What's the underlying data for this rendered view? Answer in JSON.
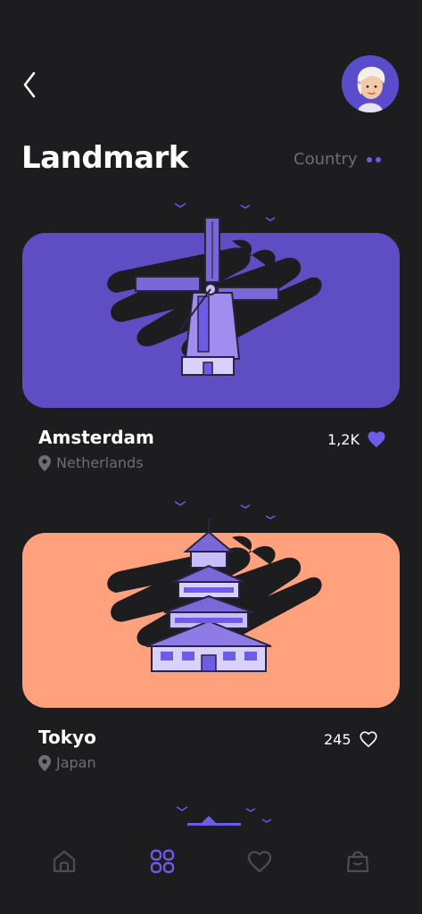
{
  "header": {
    "back_icon": "chevron-left-icon",
    "avatar_icon": "user-avatar"
  },
  "page": {
    "title": "Landmark",
    "filter_label": "Country"
  },
  "landmarks": [
    {
      "city": "Amsterdam",
      "country": "Netherlands",
      "likes": "1,2K",
      "liked": true,
      "card_color": "#5f4dc3",
      "illustration": "windmill"
    },
    {
      "city": "Tokyo",
      "country": "Japan",
      "likes": "245",
      "liked": false,
      "card_color": "#ffa17d",
      "illustration": "japanese-castle"
    }
  ],
  "bottom_nav": {
    "items": [
      {
        "icon": "home-icon",
        "active": false
      },
      {
        "icon": "grid-icon",
        "active": true
      },
      {
        "icon": "heart-icon",
        "active": false
      },
      {
        "icon": "bag-icon",
        "active": false
      }
    ]
  },
  "colors": {
    "background": "#1d1c1e",
    "accent": "#6c5ce7",
    "muted_text": "#6f6c76",
    "nav_inactive": "#4f4c55"
  }
}
